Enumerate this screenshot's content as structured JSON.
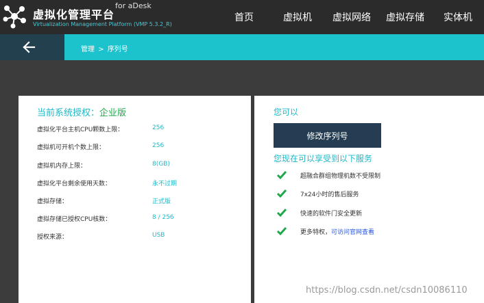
{
  "header": {
    "title": "虚拟化管理平台",
    "for_label": "for aDesk",
    "subtitle": "Virtualization Management Platform (VMP 5.3.2_R)",
    "nav": [
      {
        "label": "首页"
      },
      {
        "label": "虚拟机"
      },
      {
        "label": "虚拟网络"
      },
      {
        "label": "虚拟存储"
      },
      {
        "label": "实体机"
      }
    ]
  },
  "breadcrumb": {
    "parent": "管理",
    "separator": ">",
    "current": "序列号"
  },
  "license": {
    "title_prefix": "当前系统授权：",
    "edition": "企业版",
    "rows": [
      {
        "label": "虚拟化平台主机CPU颗数上限：",
        "value": "256"
      },
      {
        "label": "虚拟机可开机个数上限：",
        "value": "256"
      },
      {
        "label": "虚拟机内存上限：",
        "value": "8(GB)"
      },
      {
        "label": "虚拟化平台剩余使用天数：",
        "value": "永不过期"
      },
      {
        "label": "虚拟存储：",
        "value": "正式版"
      },
      {
        "label": "虚拟存储已授权CPU核数：",
        "value": "8 / 256"
      },
      {
        "label": "授权来源：",
        "value": "USB"
      }
    ]
  },
  "actions": {
    "title": "您可以",
    "modify_button": "修改序列号",
    "services_title": "您现在可以享受到以下服务",
    "services": [
      {
        "text": "超融合群组物理机数不受限制"
      },
      {
        "text": "7x24小时的售后服务"
      },
      {
        "text": "快速的软件门安全更新"
      },
      {
        "text": "更多特权，",
        "link": "可访问官网查看"
      }
    ]
  },
  "watermark": "https://blog.csdn.net/csdn10086110",
  "colors": {
    "accent": "#1cc2cc",
    "dark_nav": "#2b2b2b",
    "button": "#253d52",
    "success": "#1fa84a"
  }
}
